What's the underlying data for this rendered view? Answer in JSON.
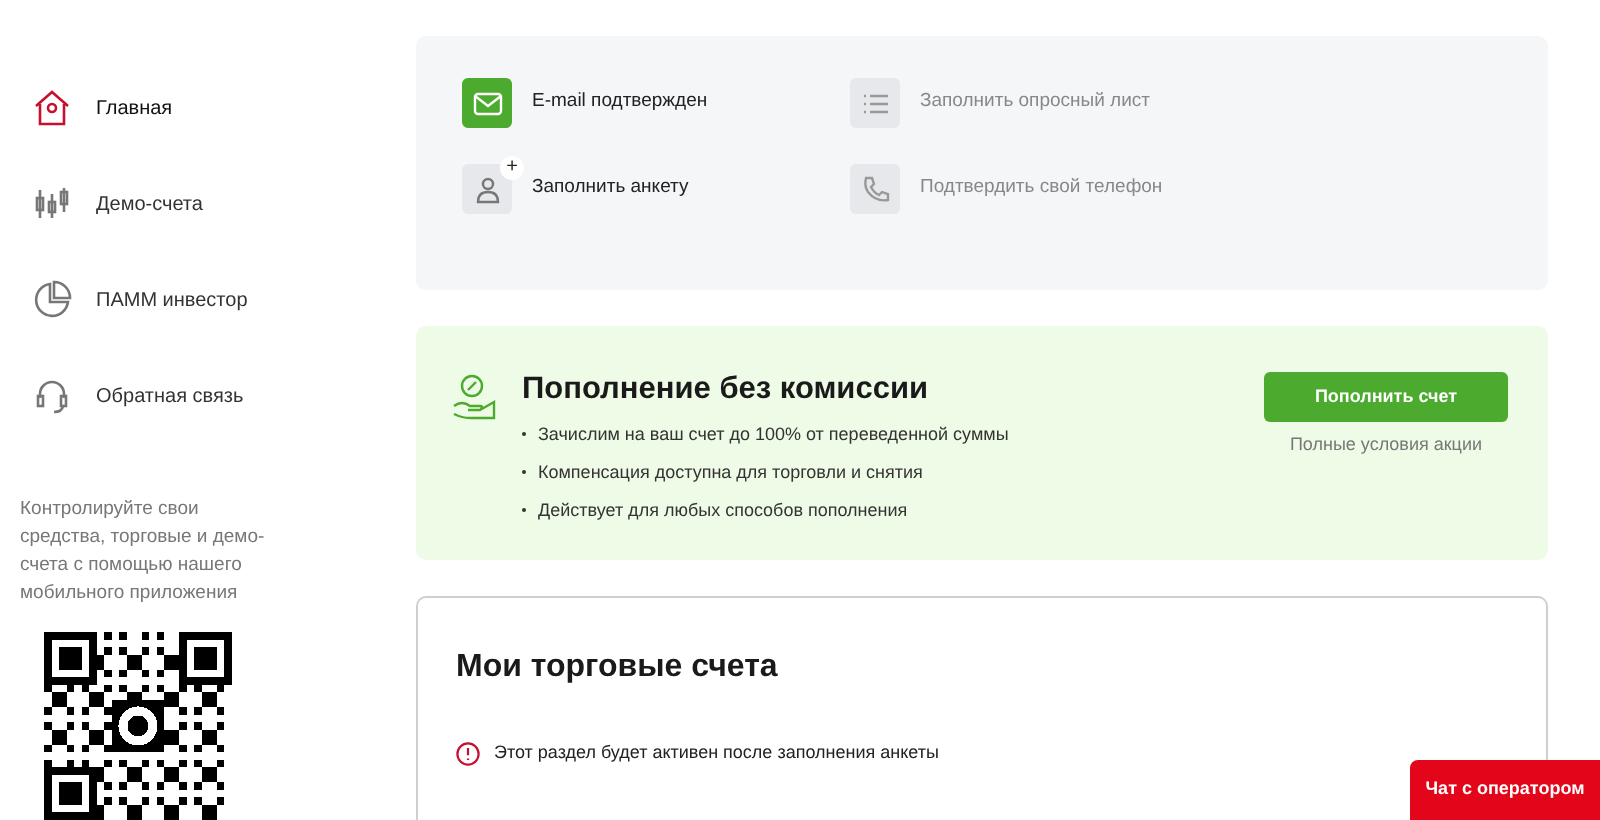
{
  "sidebar": {
    "items": [
      {
        "kind": "home",
        "label": "Главная",
        "selected": true
      },
      {
        "kind": "candles",
        "label": "Демо-счета",
        "selected": false
      },
      {
        "kind": "pie",
        "label": "ПАММ инвестор",
        "selected": false
      },
      {
        "kind": "headset",
        "label": "Обратная связь",
        "selected": false
      }
    ],
    "app_promo": "Контролируйте свои средства, торговые и демо-счета с помощью нашего мобильного приложения"
  },
  "steps": [
    {
      "kind": "email",
      "label": "E-mail подтвержден",
      "done": true,
      "disabled": false
    },
    {
      "kind": "list",
      "label": "Заполнить опросный лист",
      "done": false,
      "disabled": true
    },
    {
      "kind": "person",
      "label": "Заполнить анкету",
      "done": false,
      "disabled": false,
      "badge": "+"
    },
    {
      "kind": "phone",
      "label": "Подтвердить свой телефон",
      "done": false,
      "disabled": true
    }
  ],
  "promo": {
    "title": "Пополнение без комиссии",
    "bullets": [
      "Зачислим на ваш счет до 100% от переведенной суммы",
      "Компенсация доступна для торговли и снятия",
      "Действует для любых способов пополнения"
    ],
    "button": "Пополнить счет",
    "link": "Полные условия акции"
  },
  "accounts": {
    "title": "Мои торговые счета",
    "notice": "Этот раздел будет активен после заполнения анкеты"
  },
  "chat_button": "Чат с оператором"
}
